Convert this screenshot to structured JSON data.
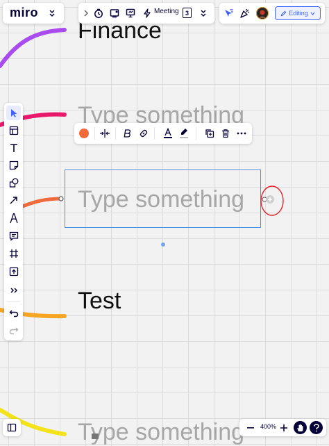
{
  "app": {
    "logo": "miro"
  },
  "top_tools": {
    "meeting_label": "Meeting",
    "count_badge": "3"
  },
  "top_right": {
    "editing_label": "Editing"
  },
  "canvas": {
    "nodes": [
      {
        "text": "Finance",
        "state": "filled",
        "branch_color": "#a84cf0"
      },
      {
        "text": "Type something",
        "state": "placeholder",
        "branch_color": "#e8186b"
      },
      {
        "text": "Type something",
        "state": "placeholder",
        "branch_color": "#ef6a3c",
        "selected": true
      },
      {
        "text": "Test",
        "state": "filled",
        "branch_color": "#f6a623"
      },
      {
        "text": "Type something",
        "state": "placeholder",
        "branch_color": "#f4e21a"
      }
    ]
  },
  "context_toolbar": {
    "fill_color": "#f26a3a",
    "items": [
      "color-swatch",
      "align",
      "bold",
      "link",
      "text-color",
      "highlight",
      "duplicate",
      "delete",
      "more"
    ]
  },
  "left_toolbar": {
    "items": [
      "select",
      "frames-templates",
      "text",
      "sticky-note",
      "shapes",
      "arrow",
      "pen",
      "comment",
      "frame",
      "upload",
      "more-tools",
      "undo",
      "redo"
    ]
  },
  "zoom": {
    "level": "400%"
  },
  "colors": {
    "accent": "#4262ff",
    "annotation_circle": "#e5222b"
  }
}
